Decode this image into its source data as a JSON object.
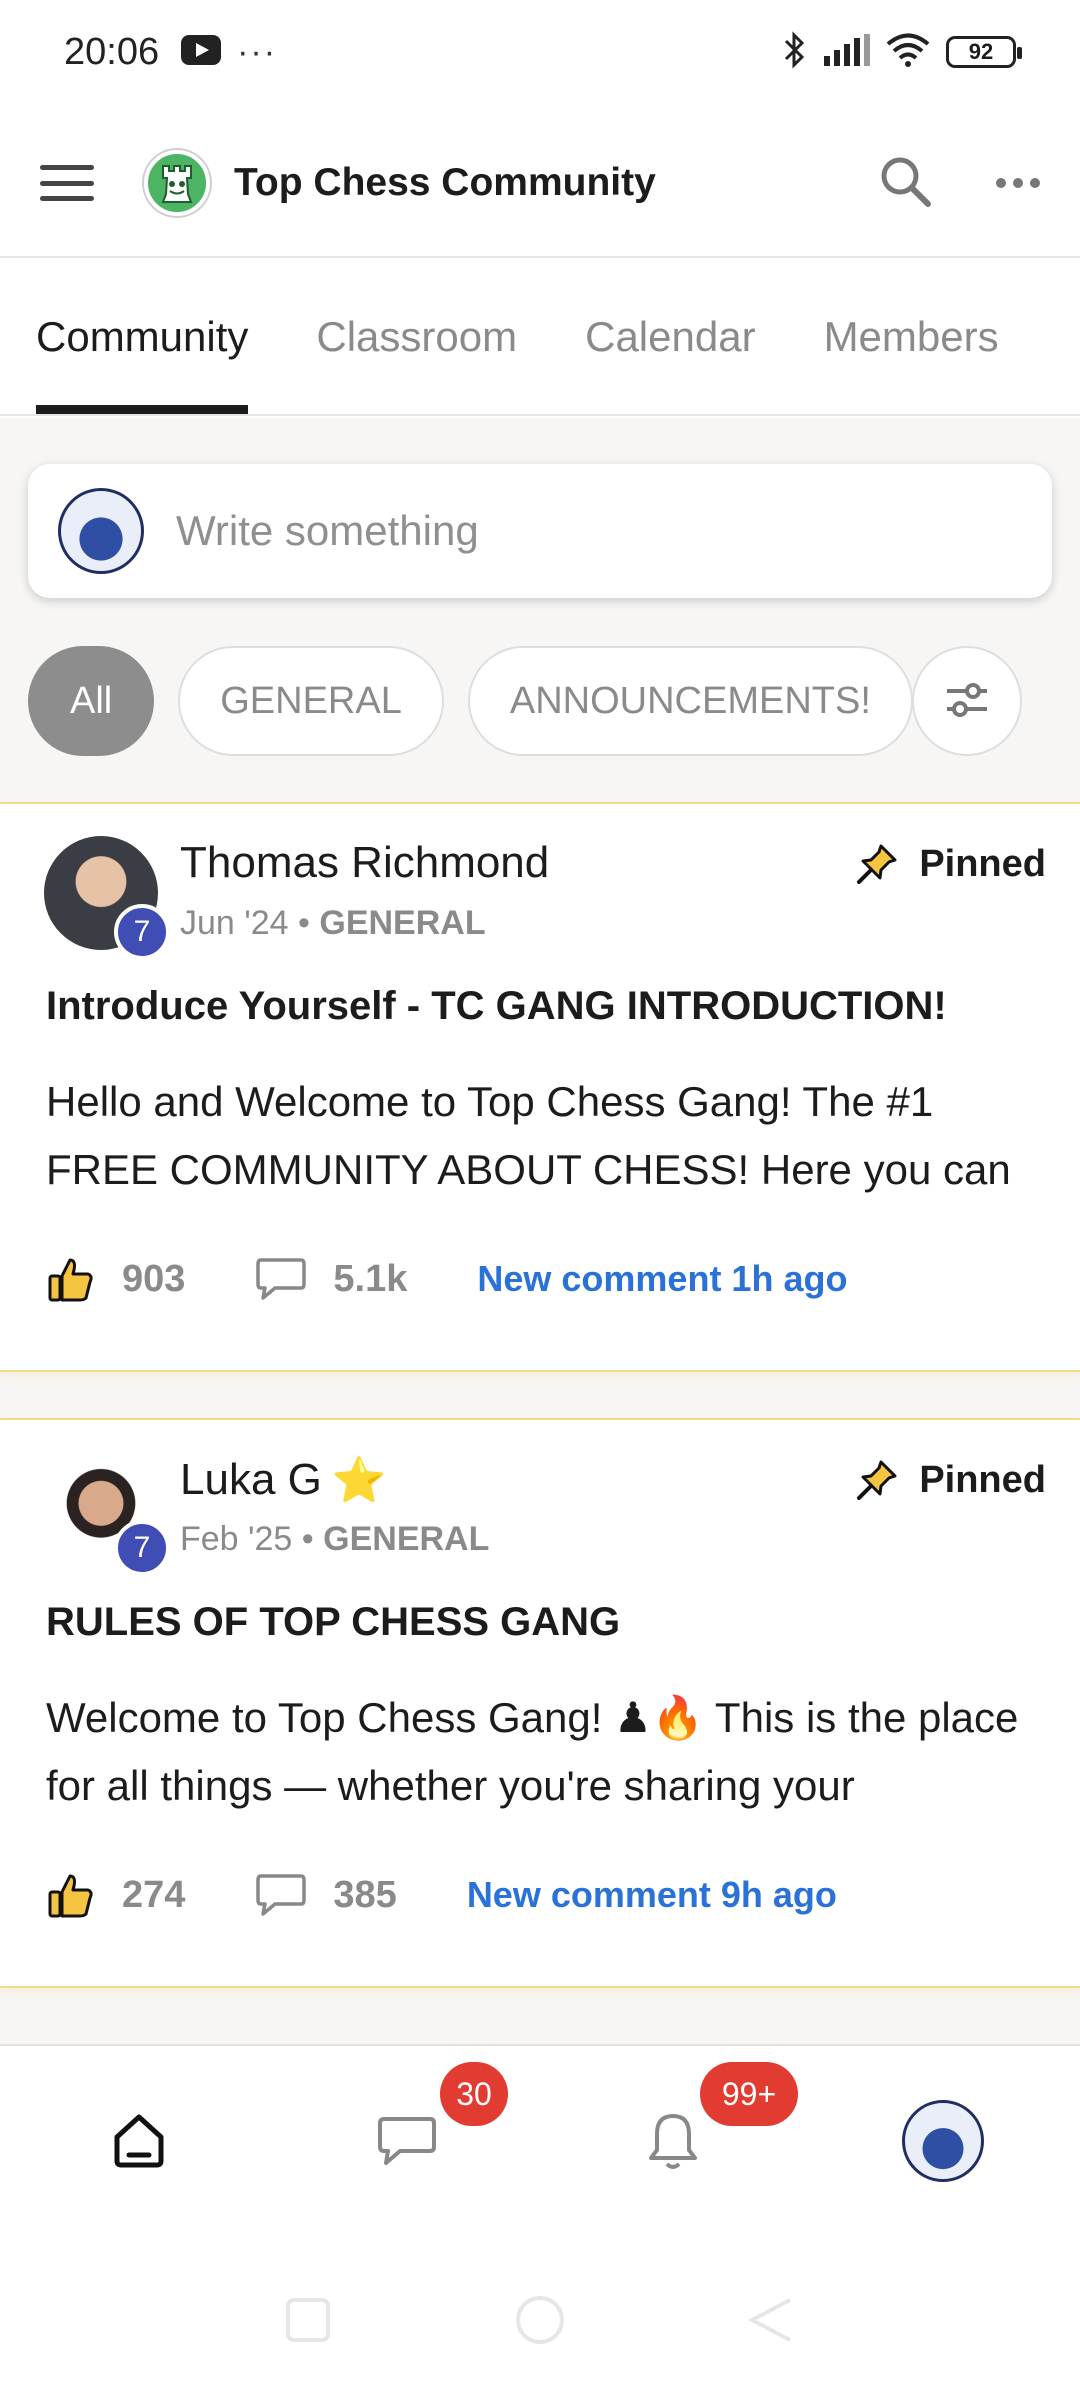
{
  "status_bar": {
    "time": "20:06",
    "dots": "···",
    "battery": "92"
  },
  "header": {
    "title": "Top Chess Community"
  },
  "tabs": [
    {
      "label": "Community",
      "active": true
    },
    {
      "label": "Classroom"
    },
    {
      "label": "Calendar"
    },
    {
      "label": "Members"
    }
  ],
  "composer": {
    "placeholder": "Write something"
  },
  "filters": [
    {
      "label": "All",
      "active": true
    },
    {
      "label": "GENERAL"
    },
    {
      "label": "ANNOUNCEMENTS!"
    }
  ],
  "posts": [
    {
      "author": "Thomas Richmond",
      "level": "7",
      "date": "Jun '24",
      "category": "GENERAL",
      "pinned_label": "Pinned",
      "title": "Introduce Yourself - TC GANG INTRODUCTION!",
      "body": "Hello and Welcome to Top Chess Gang! The #1 FREE COMMUNITY ABOUT CHESS! Here you can",
      "likes": "903",
      "comments": "5.1k",
      "new_comment": "New comment 1h ago"
    },
    {
      "author": "Luka G",
      "author_emoji": "⭐",
      "level": "7",
      "date": "Feb '25",
      "category": "GENERAL",
      "pinned_label": "Pinned",
      "title": "RULES OF TOP CHESS GANG",
      "body": "Welcome to Top Chess Gang! ♟🔥 This is the place for all things — whether you're sharing your",
      "likes": "274",
      "comments": "385",
      "new_comment": "New comment 9h ago"
    }
  ],
  "bottom_nav": {
    "chat_badge": "30",
    "notifications_badge": "99+"
  },
  "colors": {
    "accent_link": "#2a71d8",
    "level_badge": "#3f4db4",
    "notif_badge": "#e13b32",
    "active_chip": "#8d8d8d"
  }
}
